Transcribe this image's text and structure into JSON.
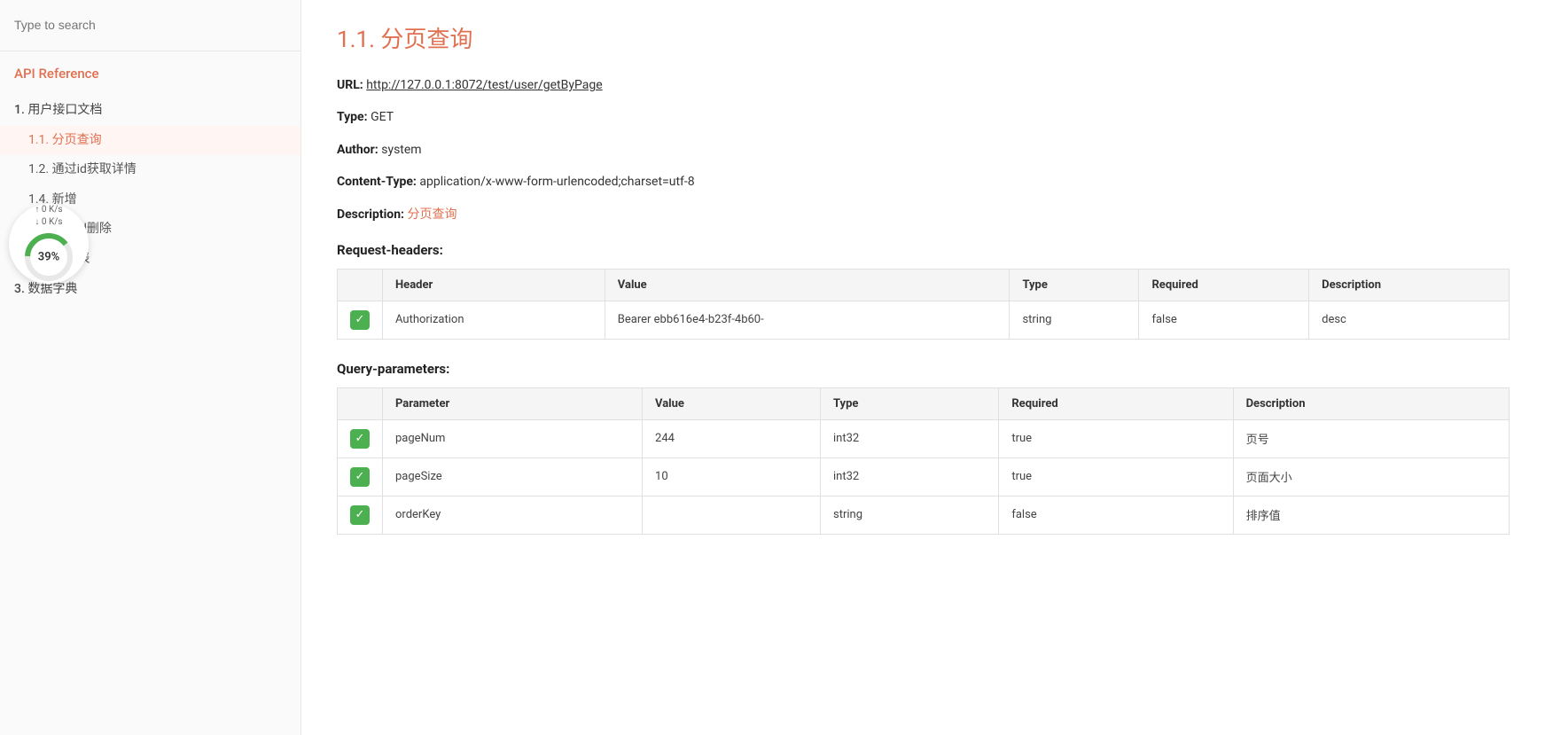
{
  "sidebar": {
    "search_placeholder": "Type to search",
    "section_title": "API Reference",
    "nav_items": [
      {
        "id": "section1",
        "label": "1. 用户接口文档",
        "level": 1
      },
      {
        "id": "section1-1",
        "label": "1.1. 分页查询",
        "level": 2,
        "active": true
      },
      {
        "id": "section1-2",
        "label": "1.2. 通过id获取详情",
        "level": 2
      },
      {
        "id": "section1-4",
        "label": "1.4. 新增",
        "level": 2
      },
      {
        "id": "section1-5",
        "label": "1.5. 通过id删除",
        "level": 2
      },
      {
        "id": "section2",
        "label": "2. 错误码列表",
        "level": 1
      },
      {
        "id": "section3",
        "label": "3. 数据字典",
        "level": 1
      }
    ]
  },
  "network_widget": {
    "upload": "↑ 0  K/s",
    "download": "↓ 0  K/s",
    "percent": "39%"
  },
  "main": {
    "page_title": "1.1. 分页查询",
    "url_label": "URL:",
    "url_value": "http://127.0.0.1:8072/test/user/getByPage",
    "type_label": "Type:",
    "type_value": "GET",
    "author_label": "Author:",
    "author_value": "system",
    "content_type_label": "Content-Type:",
    "content_type_value": "application/x-www-form-urlencoded;charset=utf-8",
    "description_label": "Description:",
    "description_value": "分页查询",
    "request_headers_label": "Request-headers:",
    "headers_table": {
      "columns": [
        "Header",
        "Value",
        "Type",
        "Required",
        "Description"
      ],
      "rows": [
        {
          "name": "Authorization",
          "value": "Bearer ebb616e4-b23f-4b60-",
          "type": "string",
          "required": "false",
          "description": "desc"
        }
      ]
    },
    "query_parameters_label": "Query-parameters:",
    "params_table": {
      "columns": [
        "Parameter",
        "Value",
        "Type",
        "Required",
        "Description"
      ],
      "rows": [
        {
          "name": "pageNum",
          "value": "244",
          "type": "int32",
          "required": "true",
          "description": "页号"
        },
        {
          "name": "pageSize",
          "value": "10",
          "type": "int32",
          "required": "true",
          "description": "页面大小"
        },
        {
          "name": "orderKey",
          "value": "",
          "type": "string",
          "required": "false",
          "description": "排序值"
        }
      ]
    }
  }
}
